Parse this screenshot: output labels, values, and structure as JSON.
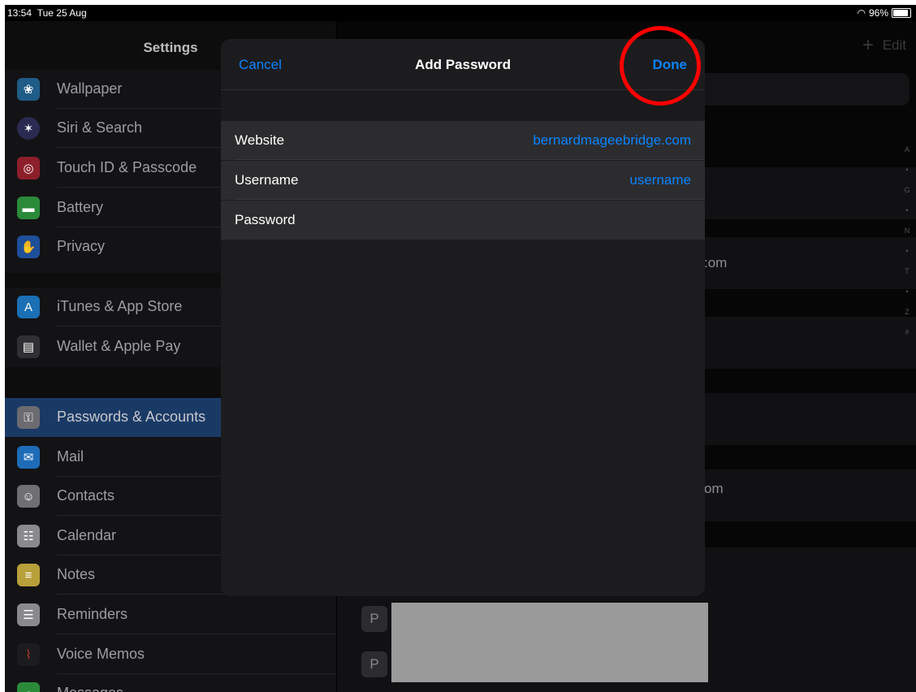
{
  "status": {
    "time": "13:54",
    "date": "Tue 25 Aug",
    "battery": "96%"
  },
  "sidebar": {
    "title": "Settings",
    "items": [
      {
        "label": "Wallpaper",
        "icon": "wallpaper-icon",
        "color": "#1f5c87"
      },
      {
        "label": "Siri & Search",
        "icon": "siri-icon",
        "color": "#2a2a52"
      },
      {
        "label": "Touch ID & Passcode",
        "icon": "fingerprint-icon",
        "color": "#8c1f2a"
      },
      {
        "label": "Battery",
        "icon": "battery-icon",
        "color": "#2b8a3a"
      },
      {
        "label": "Privacy",
        "icon": "hand-icon",
        "color": "#1e4f9a"
      },
      {
        "label": "iTunes & App Store",
        "icon": "app-store-icon",
        "color": "#1a6fb5"
      },
      {
        "label": "Wallet & Apple Pay",
        "icon": "wallet-icon",
        "color": "#303033"
      },
      {
        "label": "Passwords & Accounts",
        "icon": "key-icon",
        "color": "#6b6b70"
      },
      {
        "label": "Mail",
        "icon": "mail-icon",
        "color": "#1e6cb8"
      },
      {
        "label": "Contacts",
        "icon": "contacts-icon",
        "color": "#707074"
      },
      {
        "label": "Calendar",
        "icon": "calendar-icon",
        "color": "#8a8a8e"
      },
      {
        "label": "Notes",
        "icon": "notes-icon",
        "color": "#b8a03a"
      },
      {
        "label": "Reminders",
        "icon": "reminders-icon",
        "color": "#8a8a8e"
      },
      {
        "label": "Voice Memos",
        "icon": "voice-memos-icon",
        "color": "#1c1c1e"
      },
      {
        "label": "Messages",
        "icon": "messages-icon",
        "color": "#2b8a3a"
      }
    ]
  },
  "detail": {
    "add_label": "+",
    "edit_label": "Edit",
    "partial_1": ":om",
    "partial_2": "om",
    "index": [
      "A",
      "•",
      "G",
      "•",
      "N",
      "•",
      "T",
      "•",
      "Z",
      "#"
    ],
    "badge_letter": "P"
  },
  "modal": {
    "cancel_label": "Cancel",
    "title": "Add Password",
    "done_label": "Done",
    "fields": [
      {
        "label": "Website",
        "value": "bernardmageebridge.com"
      },
      {
        "label": "Username",
        "value": "username"
      },
      {
        "label": "Password",
        "value": ""
      }
    ]
  },
  "colors": {
    "accent": "#0a84ff",
    "annotation": "#ff0000"
  }
}
